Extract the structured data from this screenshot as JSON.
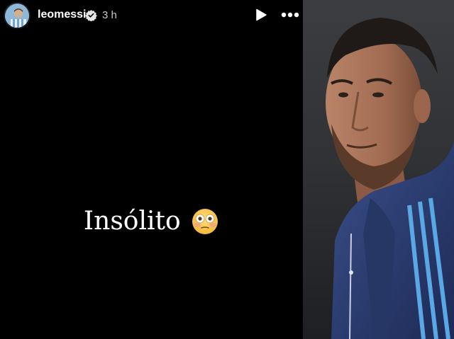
{
  "story": {
    "username": "leomessi",
    "verified": true,
    "timestamp": "3 h",
    "caption": "Insólito",
    "emoji": "flushed-face",
    "icons": {
      "avatar": "profile-avatar",
      "play": "play-icon",
      "more": "more-options-icon",
      "verified": "verified-badge-icon"
    }
  },
  "photo": {
    "description_icon": "portrait-photo"
  },
  "colors": {
    "story_bg": "#000000",
    "text": "#ffffff",
    "timestamp": "#c9c9c9",
    "jersey": "#2c3f73",
    "stripe": "#5aa7e6"
  }
}
